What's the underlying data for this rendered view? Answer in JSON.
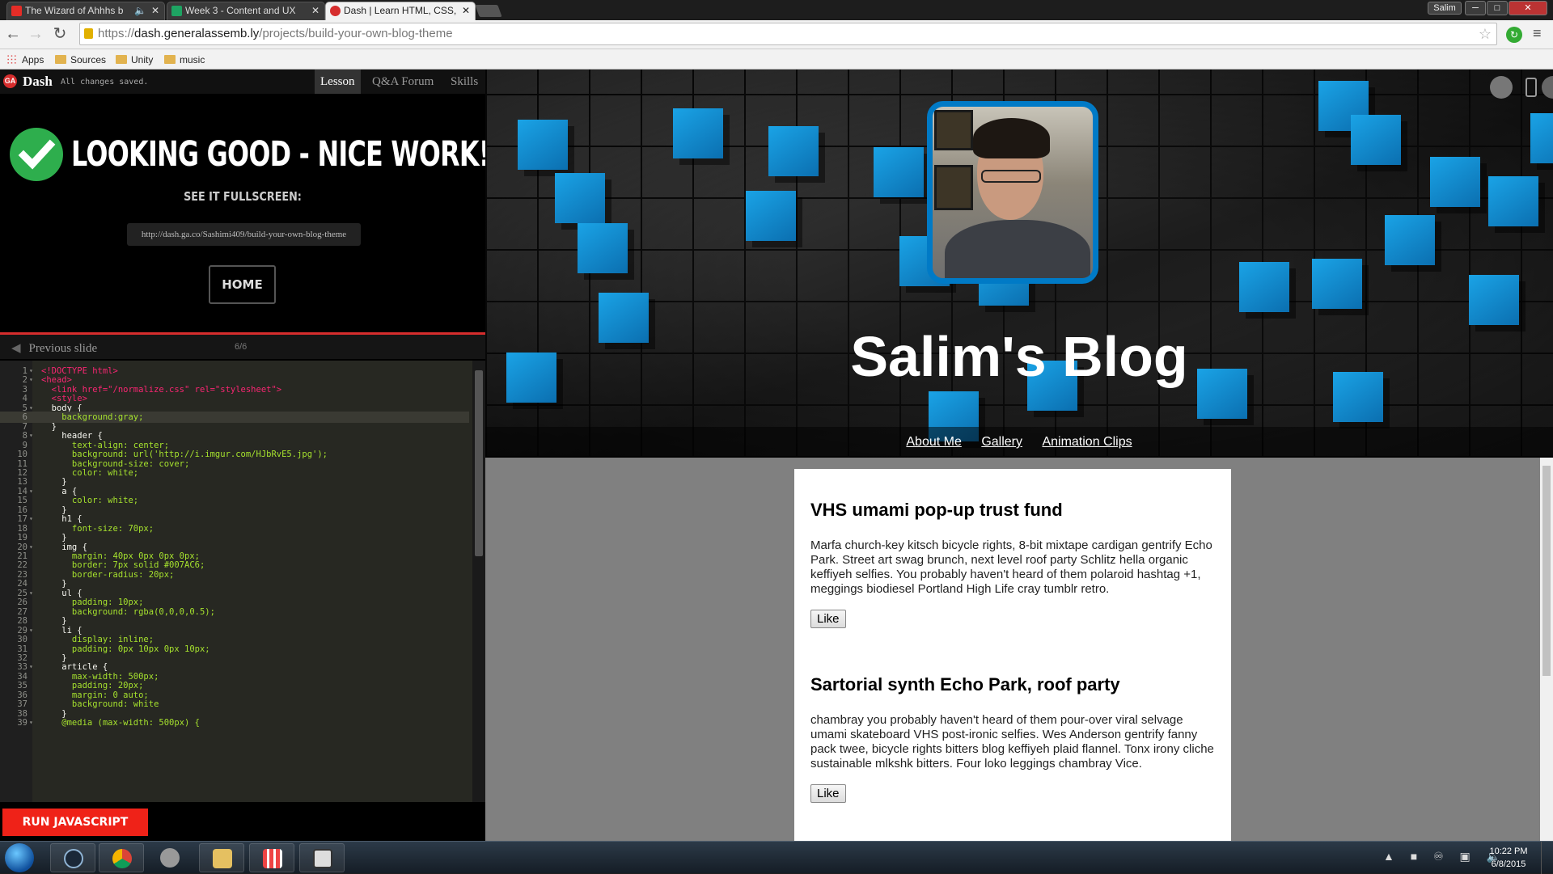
{
  "browser": {
    "tabs": [
      {
        "title": "The Wizard of Ahhhs b",
        "icon": "youtube-icon",
        "color": "#e52d27"
      },
      {
        "title": "Week 3 - Content and UX",
        "icon": "s-icon",
        "color": "#1ea362"
      },
      {
        "title": "Dash | Learn HTML, CSS, J",
        "icon": "ga-icon",
        "color": "#d62d2d"
      }
    ],
    "user": "Salim",
    "url_scheme": "https://",
    "url_host": "dash.generalassemb.ly",
    "url_path": "/projects/build-your-own-blog-theme",
    "bookmarks": [
      "Apps",
      "Sources",
      "Unity",
      "music"
    ]
  },
  "dash": {
    "brand": "Dash",
    "logo": "GA",
    "status": "All changes saved.",
    "nav": [
      "Lesson",
      "Q&A Forum",
      "Skills"
    ],
    "success_title": "LOOKING GOOD - NICE WORK!",
    "fullscreen_label": "SEE IT FULLSCREEN:",
    "fullscreen_url": "http://dash.ga.co/Sashimi409/build-your-own-blog-theme",
    "home_button": "HOME",
    "previous_slide": "Previous slide",
    "slide_counter": "6/6",
    "run_button": "RUN JAVASCRIPT"
  },
  "code_lines": [
    "<!DOCTYPE html>",
    "<head>",
    "  <link href=\"/normalize.css\" rel=\"stylesheet\">",
    "  <style>",
    "  body {",
    "    background:gray;",
    "  }",
    "    header {",
    "      text-align: center;",
    "      background: url('http://i.imgur.com/HJbRvE5.jpg');",
    "      background-size: cover;",
    "      color: white;",
    "    }",
    "    a {",
    "      color: white;",
    "    }",
    "    h1 {",
    "      font-size: 70px;",
    "    }",
    "    img {",
    "      margin: 40px 0px 0px 0px;",
    "      border: 7px solid #007AC6;",
    "      border-radius: 20px;",
    "    }",
    "    ul {",
    "      padding: 10px;",
    "      background: rgba(0,0,0,0.5);",
    "    }",
    "    li {",
    "      display: inline;",
    "      padding: 0px 10px 0px 10px;",
    "    }",
    "    article {",
    "      max-width: 500px;",
    "      padding: 20px;",
    "      margin: 0 auto;",
    "      background: white",
    "    }",
    "    @media (max-width: 500px) {"
  ],
  "blog": {
    "title": "Salim's Blog",
    "nav": [
      "About Me",
      "Gallery",
      "Animation Clips"
    ],
    "articles": [
      {
        "heading": "VHS umami pop-up trust fund",
        "body": "Marfa church-key kitsch bicycle rights, 8-bit mixtape cardigan gentrify Echo Park. Street art swag brunch, next level roof party Schlitz hella organic keffiyeh selfies. You probably haven't heard of them polaroid hashtag +1, meggings biodiesel Portland High Life cray tumblr retro.",
        "like": "Like"
      },
      {
        "heading": "Sartorial synth Echo Park, roof party",
        "body": "chambray you probably haven't heard of them pour-over viral selvage umami skateboard VHS post-ironic selfies. Wes Anderson gentrify fanny pack twee, bicycle rights bitters blog keffiyeh plaid flannel. Tonx irony cliche sustainable mlkshk bitters. Four loko leggings chambray Vice.",
        "like": "Like"
      }
    ]
  },
  "taskbar": {
    "time": "10:22 PM",
    "date": "6/8/2015",
    "apps": [
      "steam-icon",
      "chrome-icon",
      "media-icon",
      "explorer-icon",
      "calculator-icon",
      "sketch-icon"
    ]
  },
  "colors": {
    "accent_red": "#d62d2d",
    "run_red": "#ef2218",
    "avatar_border": "#007AC6",
    "success_green": "#2eae4d"
  }
}
